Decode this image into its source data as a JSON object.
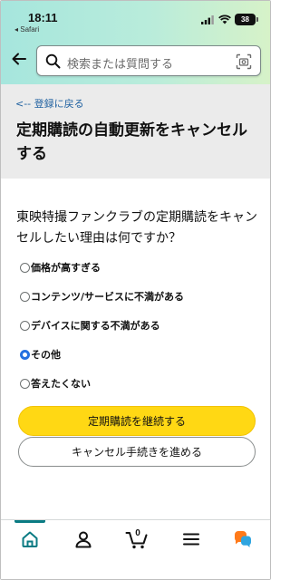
{
  "status": {
    "time": "18:11",
    "back_app": "◂ Safari",
    "battery": "38"
  },
  "search": {
    "placeholder": "検索または質問する"
  },
  "breadcrumb": "<-- 登録に戻る",
  "title": "定期購読の自動更新をキャンセルする",
  "question": "東映特撮ファンクラブの定期購読をキャンセルしたい理由は何ですか？",
  "options": [
    {
      "label": "価格が高すぎる",
      "selected": false
    },
    {
      "label": "コンテンツ/サービスに不満がある",
      "selected": false
    },
    {
      "label": "デバイスに関する不満がある",
      "selected": false
    },
    {
      "label": "その他",
      "selected": true
    },
    {
      "label": "答えたくない",
      "selected": false
    }
  ],
  "buttons": {
    "continue": "定期購読を継続する",
    "proceed": "キャンセル手続きを進める"
  },
  "cart_count": "0",
  "colors": {
    "accent": "#0a7b83",
    "link": "#2162a1",
    "primary_button": "#ffd814",
    "radio_selected": "#2570e0"
  }
}
